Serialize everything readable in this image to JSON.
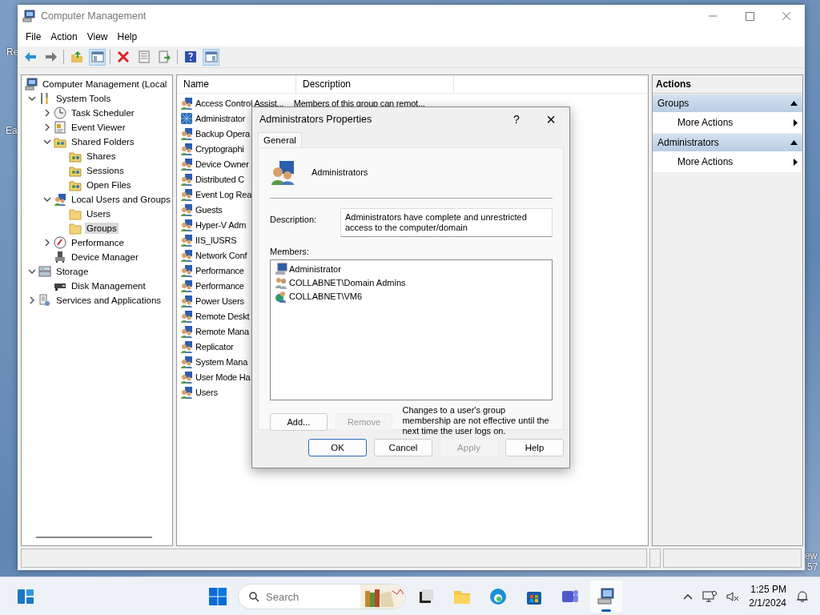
{
  "desktop": {
    "icon_labels": [
      "Re",
      "Ea",
      "ew",
      "57"
    ]
  },
  "window": {
    "title": "Computer Management",
    "active": false
  },
  "menu": [
    "File",
    "Action",
    "View",
    "Help"
  ],
  "toolbar": [
    {
      "kind": "back",
      "pressed": false
    },
    {
      "kind": "forward",
      "pressed": false
    },
    {
      "kind": "separator"
    },
    {
      "kind": "up",
      "pressed": false
    },
    {
      "kind": "tree",
      "pressed": true
    },
    {
      "kind": "separator"
    },
    {
      "kind": "delete",
      "pressed": false
    },
    {
      "kind": "properties",
      "pressed": false
    },
    {
      "kind": "export",
      "pressed": false
    },
    {
      "kind": "separator"
    },
    {
      "kind": "help",
      "pressed": false
    },
    {
      "kind": "actionpane",
      "pressed": true
    }
  ],
  "tree": [
    {
      "label": "Computer Management (Local",
      "kind": "computer",
      "selected": false,
      "children": [
        {
          "label": "System Tools",
          "kind": "tools",
          "expanded": true,
          "selected": false,
          "children": [
            {
              "label": "Task Scheduler",
              "kind": "clock",
              "expanded": false,
              "selected": false
            },
            {
              "label": "Event Viewer",
              "kind": "log",
              "expanded": false,
              "selected": false
            },
            {
              "label": "Shared Folders",
              "kind": "share",
              "expanded": true,
              "selected": false,
              "children": [
                {
                  "label": "Shares",
                  "kind": "share",
                  "selected": false
                },
                {
                  "label": "Sessions",
                  "kind": "share",
                  "selected": false
                },
                {
                  "label": "Open Files",
                  "kind": "share",
                  "selected": false
                }
              ]
            },
            {
              "label": "Local Users and Groups",
              "kind": "users",
              "expanded": true,
              "selected": false,
              "children": [
                {
                  "label": "Users",
                  "kind": "folder",
                  "selected": false
                },
                {
                  "label": "Groups",
                  "kind": "folder",
                  "selected": true
                }
              ]
            },
            {
              "label": "Performance",
              "kind": "perf",
              "expanded": false,
              "selected": false
            },
            {
              "label": "Device Manager",
              "kind": "device",
              "selected": false
            }
          ]
        },
        {
          "label": "Storage",
          "kind": "storage",
          "expanded": true,
          "selected": false,
          "children": [
            {
              "label": "Disk Management",
              "kind": "disk",
              "selected": false
            }
          ]
        },
        {
          "label": "Services and Applications",
          "kind": "services",
          "expanded": false,
          "selected": false
        }
      ]
    }
  ],
  "list": {
    "columns": [
      "Name",
      "Description"
    ],
    "rows": [
      {
        "name": "Access Control Assist...",
        "description": "Members of this group can remot...",
        "selected": false
      },
      {
        "name": "Administrator",
        "selected": true
      },
      {
        "name": "Backup Opera",
        "selected": false
      },
      {
        "name": "Cryptographi",
        "selected": false
      },
      {
        "name": "Device Owner",
        "selected": false
      },
      {
        "name": "Distributed C",
        "selected": false
      },
      {
        "name": "Event Log Rea",
        "selected": false
      },
      {
        "name": "Guests",
        "selected": false
      },
      {
        "name": "Hyper-V Adm",
        "selected": false
      },
      {
        "name": "IIS_IUSRS",
        "selected": false
      },
      {
        "name": "Network Conf",
        "selected": false
      },
      {
        "name": "Performance",
        "selected": false
      },
      {
        "name": "Performance",
        "selected": false
      },
      {
        "name": "Power Users",
        "selected": false
      },
      {
        "name": "Remote Deskt",
        "selected": false
      },
      {
        "name": "Remote Mana",
        "selected": false
      },
      {
        "name": "Replicator",
        "selected": false
      },
      {
        "name": "System Mana",
        "selected": false
      },
      {
        "name": "User Mode Ha",
        "selected": false
      },
      {
        "name": "Users",
        "selected": false
      }
    ]
  },
  "actions": {
    "title": "Actions",
    "sections": [
      {
        "title": "Groups",
        "expanded": true,
        "items": [
          "More Actions"
        ]
      },
      {
        "title": "Administrators",
        "expanded": true,
        "items": [
          "More Actions"
        ]
      }
    ]
  },
  "dialog": {
    "title": "Administrators Properties",
    "help": "?",
    "close": "×",
    "tabs": [
      {
        "label": "General",
        "selected": true
      }
    ],
    "group_name": "Administrators",
    "description_label": "Description:",
    "description": "Administrators have complete and unrestricted access to the computer/domain",
    "members_label": "Members:",
    "members": [
      {
        "name": "Administrator",
        "kind": "user"
      },
      {
        "name": "COLLABNET\\Domain Admins",
        "kind": "group"
      },
      {
        "name": "COLLABNET\\VM6",
        "kind": "computer"
      }
    ],
    "member_buttons": [
      {
        "label": "Add...",
        "disabled": false
      },
      {
        "label": "Remove",
        "disabled": true
      }
    ],
    "note": "Changes to a user's group membership are not effective until the next time the user logs on.",
    "buttons": [
      {
        "label": "OK",
        "default": true,
        "disabled": false
      },
      {
        "label": "Cancel",
        "default": false,
        "disabled": false
      },
      {
        "label": "Apply",
        "default": false,
        "disabled": true
      },
      {
        "label": "Help",
        "default": false,
        "disabled": false
      }
    ]
  },
  "taskbar": {
    "search_placeholder": "Search",
    "apps": [
      {
        "kind": "taskview",
        "active": false
      },
      {
        "kind": "explorer",
        "active": false
      },
      {
        "kind": "edge",
        "active": false
      },
      {
        "kind": "store",
        "active": false
      },
      {
        "kind": "teams",
        "active": false
      },
      {
        "kind": "compmgmt",
        "active": true
      }
    ],
    "time": "1:25 PM",
    "date": "2/1/2024"
  }
}
